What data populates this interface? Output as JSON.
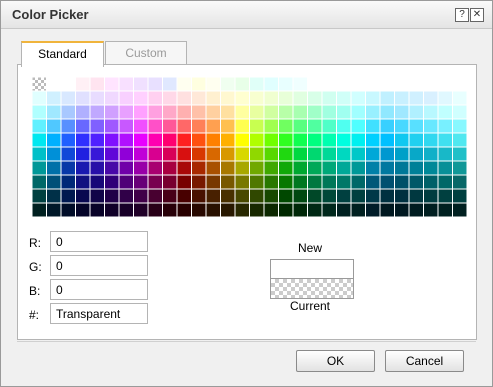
{
  "window": {
    "title": "Color Picker",
    "help_icon": "help-icon",
    "close_icon": "close-icon",
    "help_glyph": "?",
    "close_glyph": "✕"
  },
  "tabs": [
    {
      "label": "Standard",
      "active": true
    },
    {
      "label": "Custom",
      "active": false
    }
  ],
  "palette": {
    "rows": [
      [
        "transparent",
        "#ffffff",
        "#ffffff",
        "#fff0f5",
        "#ffe4f0",
        "#ffe4ff",
        "#f8e0ff",
        "#f0e0ff",
        "#e8e0ff",
        "#e0e8ff",
        "#fffff0",
        "#ffffe0",
        "#fffff0",
        "#f0fff0",
        "#e8ffe8",
        "#e0fff8",
        "#e0ffff",
        "#e8ffff",
        "#f0ffff",
        "#ffffff",
        "#ffffff",
        "#ffffff",
        "#ffffff",
        "#ffffff",
        "#ffffff",
        "#ffffff",
        "#ffffff",
        "#ffffff",
        "#ffffff",
        "#ffffff"
      ],
      [
        "#e0ffff",
        "#d0f0ff",
        "#d8e8ff",
        "#e0e0ff",
        "#e8dcff",
        "#f0d8ff",
        "#f8d0ff",
        "#ffd0ff",
        "#ffd0f0",
        "#ffd8e8",
        "#ffe0e0",
        "#ffe8d8",
        "#fff0d0",
        "#fff8d0",
        "#ffffd0",
        "#f8ffd0",
        "#f0ffd0",
        "#e8ffd8",
        "#e0ffe0",
        "#d8ffe8",
        "#d0fff0",
        "#d0fff8",
        "#d0ffff",
        "#c8f8ff",
        "#c0f0ff",
        "#c8f0ff",
        "#d0f0ff",
        "#d8f0ff",
        "#e0f8ff",
        "#e8ffff"
      ],
      [
        "#b0ffff",
        "#a0e8ff",
        "#a8c8ff",
        "#b0b0ff",
        "#c0a8ff",
        "#d0a0ff",
        "#e8a0ff",
        "#ffa0ff",
        "#ffa0e0",
        "#ffa8c8",
        "#ffb0b0",
        "#ffc0a8",
        "#ffd0a0",
        "#ffe0a0",
        "#ffffa0",
        "#e8ffa0",
        "#d0ffa0",
        "#b8ffa8",
        "#a8ffb0",
        "#a0ffc8",
        "#a0ffe0",
        "#a0fff0",
        "#a0ffff",
        "#98f0ff",
        "#90e8ff",
        "#a0e8ff",
        "#b0f0ff",
        "#b8f8ff",
        "#c0ffff",
        "#d0ffff"
      ],
      [
        "#60f0ff",
        "#50c8ff",
        "#5890ff",
        "#6868ff",
        "#8060ff",
        "#a058ff",
        "#c858ff",
        "#f050ff",
        "#ff50c8",
        "#ff5898",
        "#ff6868",
        "#ff8058",
        "#ffa050",
        "#ffc050",
        "#ffff50",
        "#c8ff50",
        "#a0ff50",
        "#70ff60",
        "#58ff80",
        "#50ffa0",
        "#50ffc8",
        "#50fff0",
        "#50ffff",
        "#40e0ff",
        "#38d0ff",
        "#48d8ff",
        "#58e0ff",
        "#68e8ff",
        "#78f0ff",
        "#88f8ff"
      ],
      [
        "#00e8f0",
        "#00b0ff",
        "#2060ff",
        "#3030ff",
        "#5020ff",
        "#8010ff",
        "#b010ff",
        "#e800ff",
        "#ff00b0",
        "#ff0070",
        "#ff2020",
        "#ff5010",
        "#ff8000",
        "#ffb000",
        "#ffff00",
        "#b0ff00",
        "#70ff00",
        "#30ff20",
        "#10ff50",
        "#00ff80",
        "#00ffb0",
        "#00ffe0",
        "#00f0f0",
        "#00d0ff",
        "#00c0ff",
        "#10c8f0",
        "#20d0f0",
        "#30d8f0",
        "#40e0f0",
        "#50e8f0"
      ],
      [
        "#00c0c8",
        "#0090d8",
        "#1048d8",
        "#2020e0",
        "#3818d8",
        "#6008d8",
        "#9000d8",
        "#c000d8",
        "#d80090",
        "#d80058",
        "#d81010",
        "#d83800",
        "#d86800",
        "#d89800",
        "#d8d800",
        "#90d800",
        "#58d800",
        "#20d810",
        "#00d840",
        "#00d870",
        "#00d898",
        "#00d8c0",
        "#00c8c8",
        "#00a8d8",
        "#0098d0",
        "#00a0c8",
        "#08a8c8",
        "#10b0c8",
        "#18b8c8",
        "#20c0c8"
      ],
      [
        "#009898",
        "#0070a8",
        "#0838a8",
        "#1818b0",
        "#2810a8",
        "#4808a8",
        "#7000a8",
        "#9800a8",
        "#a80070",
        "#a80040",
        "#a80808",
        "#a82800",
        "#a85000",
        "#a87800",
        "#a8a800",
        "#70a800",
        "#40a800",
        "#10a808",
        "#00a830",
        "#00a858",
        "#00a878",
        "#00a898",
        "#009898",
        "#0080a8",
        "#0078a0",
        "#007898",
        "#008098",
        "#008898",
        "#089098",
        "#109898"
      ],
      [
        "#006868",
        "#005078",
        "#002878",
        "#101080",
        "#180878",
        "#300078",
        "#500078",
        "#680078",
        "#780050",
        "#780030",
        "#780000",
        "#781800",
        "#783800",
        "#785800",
        "#787800",
        "#507800",
        "#287800",
        "#087800",
        "#007820",
        "#007840",
        "#007858",
        "#007868",
        "#006868",
        "#005878",
        "#005070",
        "#005068",
        "#005868",
        "#006068",
        "#006868",
        "#086868"
      ],
      [
        "#004040",
        "#003048",
        "#001850",
        "#080850",
        "#100448",
        "#200048",
        "#300048",
        "#400048",
        "#480030",
        "#480018",
        "#480000",
        "#481000",
        "#482000",
        "#483000",
        "#484800",
        "#304800",
        "#184800",
        "#004800",
        "#004810",
        "#004828",
        "#004838",
        "#004040",
        "#004040",
        "#003848",
        "#003040",
        "#003040",
        "#003840",
        "#003c40",
        "#004040",
        "#004040"
      ],
      [
        "#002020",
        "#001828",
        "#000c28",
        "#040428",
        "#080228",
        "#100028",
        "#180028",
        "#200028",
        "#280018",
        "#280008",
        "#280000",
        "#280800",
        "#281000",
        "#281800",
        "#282800",
        "#182800",
        "#0c2800",
        "#002800",
        "#002808",
        "#002814",
        "#00281c",
        "#002020",
        "#002020",
        "#001c28",
        "#001820",
        "#001820",
        "#001c20",
        "#001e20",
        "#002020",
        "#002020"
      ]
    ]
  },
  "rgb": {
    "r_label": "R:",
    "g_label": "G:",
    "b_label": "B:",
    "hex_label": "#:",
    "r_value": "0",
    "g_value": "0",
    "b_value": "0",
    "hex_value": "Transparent"
  },
  "preview": {
    "new_label": "New",
    "current_label": "Current"
  },
  "buttons": {
    "ok": "OK",
    "cancel": "Cancel"
  }
}
